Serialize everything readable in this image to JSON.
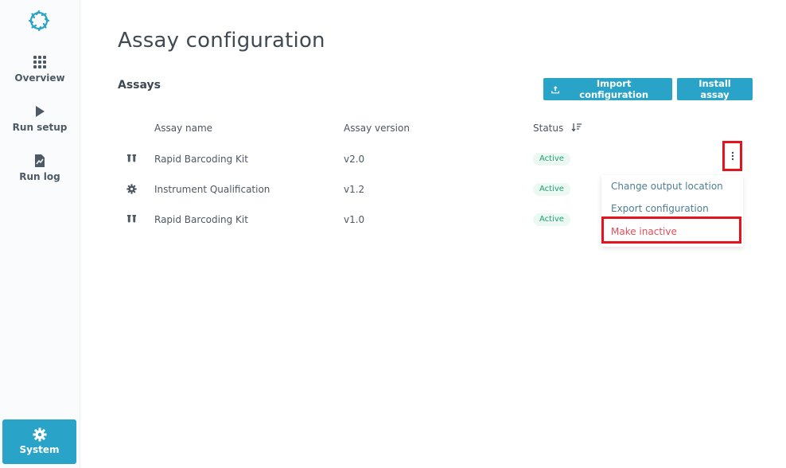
{
  "page": {
    "title": "Assay configuration",
    "section_title": "Assays"
  },
  "sidebar": {
    "items": [
      {
        "label": "Overview",
        "icon": "grid-icon"
      },
      {
        "label": "Run setup",
        "icon": "play-icon"
      },
      {
        "label": "Run log",
        "icon": "document-chart-icon"
      }
    ],
    "system": {
      "label": "System",
      "icon": "gear-icon"
    },
    "accent": "#2aa3c9"
  },
  "toolbar": {
    "import_label": "Import configuration",
    "install_label": "Install assay"
  },
  "table": {
    "headers": {
      "name": "Assay name",
      "version": "Assay version",
      "status": "Status"
    },
    "rows": [
      {
        "icon": "tube-icon",
        "name": "Rapid Barcoding Kit",
        "version": "v2.0",
        "status": "Active"
      },
      {
        "icon": "gear-icon",
        "name": "Instrument Qualification",
        "version": "v1.2",
        "status": "Active"
      },
      {
        "icon": "tube-icon",
        "name": "Rapid Barcoding Kit",
        "version": "v1.0",
        "status": "Active"
      }
    ]
  },
  "context_menu": {
    "items": [
      "Change output location",
      "Export configuration",
      "Make inactive"
    ]
  }
}
